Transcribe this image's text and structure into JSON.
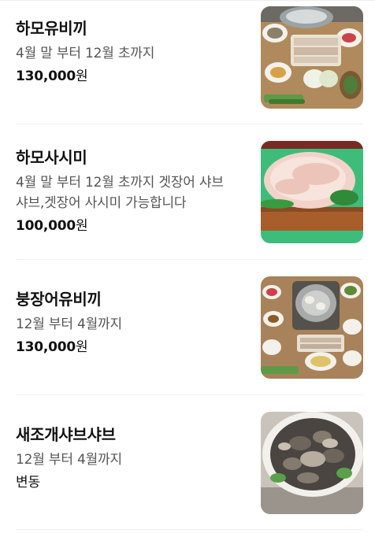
{
  "menu": {
    "items": [
      {
        "name": "하모유비끼",
        "desc_lines": [
          "4월 말 부터 12월 초까지"
        ],
        "price_value": "130,000",
        "price_unit": "원",
        "photo": "hamo-yubiki-table-photo"
      },
      {
        "name": "하모사시미",
        "desc_lines": [
          "4월 말 부터 12월 초까지 겟장어 샤브",
          "샤브,겟장어 사시미 가능합니다"
        ],
        "price_value": "100,000",
        "price_unit": "원",
        "photo": "hamo-sashimi-platter-photo"
      },
      {
        "name": "붕장어유비끼",
        "desc_lines": [
          "12월 부터 4월까지"
        ],
        "price_value": "130,000",
        "price_unit": "원",
        "photo": "conger-yubiki-table-photo"
      },
      {
        "name": "새조개샤브샤브",
        "desc_lines": [
          "12월 부터 4월까지"
        ],
        "price_value": null,
        "price_unit": null,
        "price_text": "변동",
        "photo": "cockle-shabu-platter-photo"
      }
    ]
  },
  "colors": {
    "text_primary": "#111111",
    "text_secondary": "#555555",
    "divider": "#eeeeee"
  }
}
